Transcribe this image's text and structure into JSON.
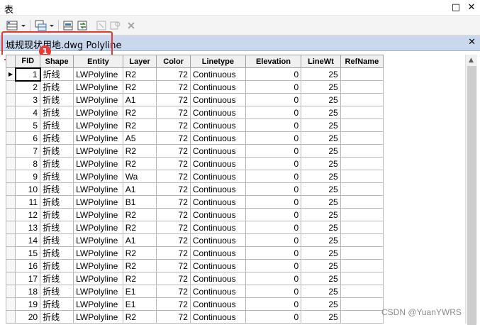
{
  "window": {
    "title": "表",
    "restore_glyph": "□",
    "close_glyph": "✕"
  },
  "toolbar": {
    "icons": [
      "table-options-icon",
      "dropdown-arrow-icon",
      "related-tables-icon",
      "dropdown-arrow-icon",
      "select-by-attributes-icon",
      "switch-selection-icon",
      "clear-selection-icon",
      "zoom-to-selected-icon",
      "delete-selected-icon"
    ]
  },
  "tab": {
    "title": "城规现状用地.dwg Polyline",
    "close_glyph": "✕"
  },
  "annotation": {
    "badge": "1",
    "color": "#e53935"
  },
  "table": {
    "columns": [
      "FID",
      "Shape",
      "Entity",
      "Layer",
      "Color",
      "Linetype",
      "Elevation",
      "LineWt",
      "RefName"
    ],
    "rows": [
      [
        "1",
        "折线",
        "LWPolyline",
        "R2",
        "72",
        "Continuous",
        "0",
        "25",
        ""
      ],
      [
        "2",
        "折线",
        "LWPolyline",
        "R2",
        "72",
        "Continuous",
        "0",
        "25",
        ""
      ],
      [
        "3",
        "折线",
        "LWPolyline",
        "A1",
        "72",
        "Continuous",
        "0",
        "25",
        ""
      ],
      [
        "4",
        "折线",
        "LWPolyline",
        "R2",
        "72",
        "Continuous",
        "0",
        "25",
        ""
      ],
      [
        "5",
        "折线",
        "LWPolyline",
        "R2",
        "72",
        "Continuous",
        "0",
        "25",
        ""
      ],
      [
        "6",
        "折线",
        "LWPolyline",
        "A5",
        "72",
        "Continuous",
        "0",
        "25",
        ""
      ],
      [
        "7",
        "折线",
        "LWPolyline",
        "R2",
        "72",
        "Continuous",
        "0",
        "25",
        ""
      ],
      [
        "8",
        "折线",
        "LWPolyline",
        "R2",
        "72",
        "Continuous",
        "0",
        "25",
        ""
      ],
      [
        "9",
        "折线",
        "LWPolyline",
        "Wa",
        "72",
        "Continuous",
        "0",
        "25",
        ""
      ],
      [
        "10",
        "折线",
        "LWPolyline",
        "A1",
        "72",
        "Continuous",
        "0",
        "25",
        ""
      ],
      [
        "11",
        "折线",
        "LWPolyline",
        "B1",
        "72",
        "Continuous",
        "0",
        "25",
        ""
      ],
      [
        "12",
        "折线",
        "LWPolyline",
        "R2",
        "72",
        "Continuous",
        "0",
        "25",
        ""
      ],
      [
        "13",
        "折线",
        "LWPolyline",
        "R2",
        "72",
        "Continuous",
        "0",
        "25",
        ""
      ],
      [
        "14",
        "折线",
        "LWPolyline",
        "A1",
        "72",
        "Continuous",
        "0",
        "25",
        ""
      ],
      [
        "15",
        "折线",
        "LWPolyline",
        "R2",
        "72",
        "Continuous",
        "0",
        "25",
        ""
      ],
      [
        "16",
        "折线",
        "LWPolyline",
        "R2",
        "72",
        "Continuous",
        "0",
        "25",
        ""
      ],
      [
        "17",
        "折线",
        "LWPolyline",
        "R2",
        "72",
        "Continuous",
        "0",
        "25",
        ""
      ],
      [
        "18",
        "折线",
        "LWPolyline",
        "E1",
        "72",
        "Continuous",
        "0",
        "25",
        ""
      ],
      [
        "19",
        "折线",
        "LWPolyline",
        "E1",
        "72",
        "Continuous",
        "0",
        "25",
        ""
      ],
      [
        "20",
        "折线",
        "LWPolyline",
        "R2",
        "72",
        "Continuous",
        "0",
        "25",
        ""
      ]
    ]
  },
  "watermark": "CSDN @YuanYWRS"
}
